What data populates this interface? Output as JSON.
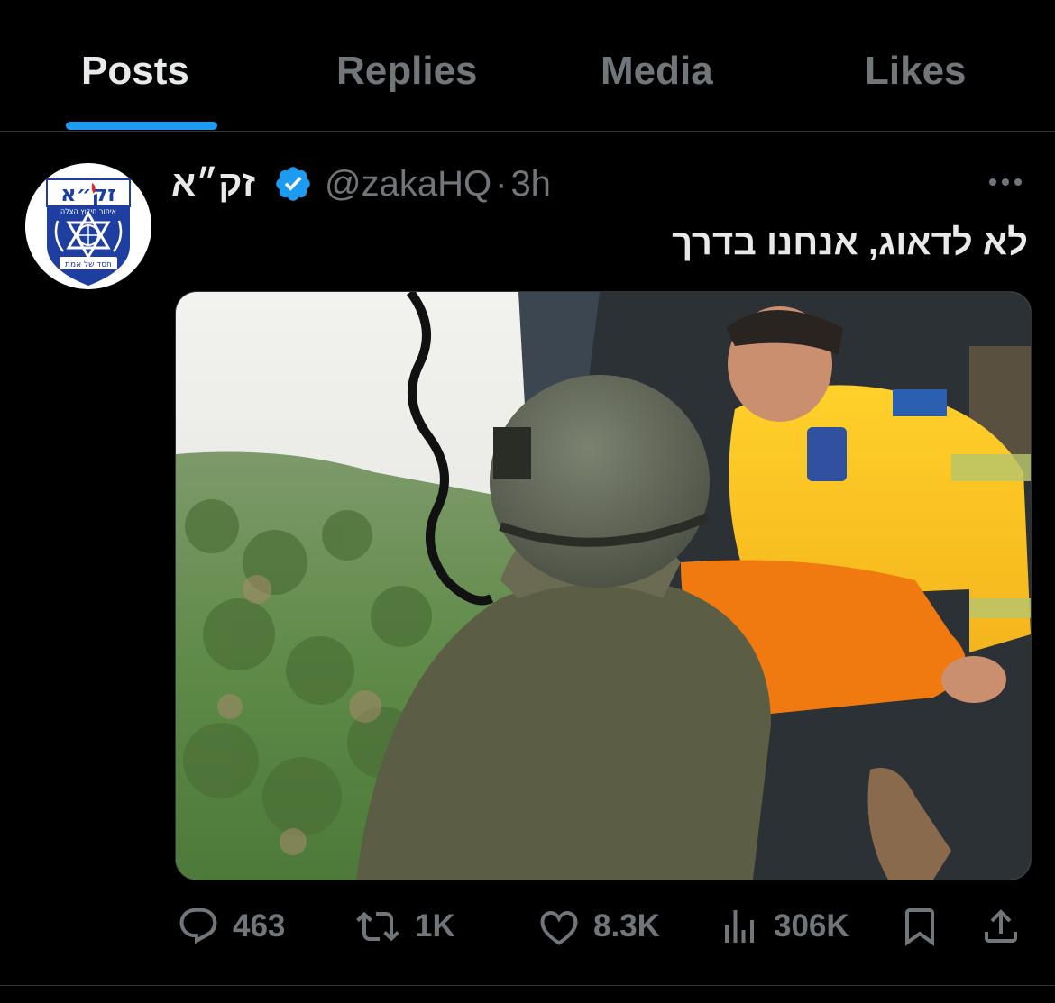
{
  "tabs": [
    {
      "label": "Posts",
      "active": true
    },
    {
      "label": "Replies",
      "active": false
    },
    {
      "label": "Media",
      "active": false
    },
    {
      "label": "Likes",
      "active": false
    }
  ],
  "tweet": {
    "display_name": "זק״א",
    "verified": true,
    "handle": "@zakaHQ",
    "separator": "·",
    "time": "3h",
    "text": "לא לדאוג, אנחנו בדרך",
    "avatar_logo": {
      "title": "זק״א",
      "subtitle": "איתור חילוץ הצלה",
      "motto": "חסד של אמת"
    },
    "media_icon": "photo-helicopter-rescue",
    "actions": {
      "replies": "463",
      "retweets": "1K",
      "likes": "8.3K",
      "views": "306K"
    }
  },
  "colors": {
    "background": "#000000",
    "primary_text": "#e7e9ea",
    "secondary_text": "#71767b",
    "accent": "#1d9bf0",
    "divider": "#2f3336"
  }
}
